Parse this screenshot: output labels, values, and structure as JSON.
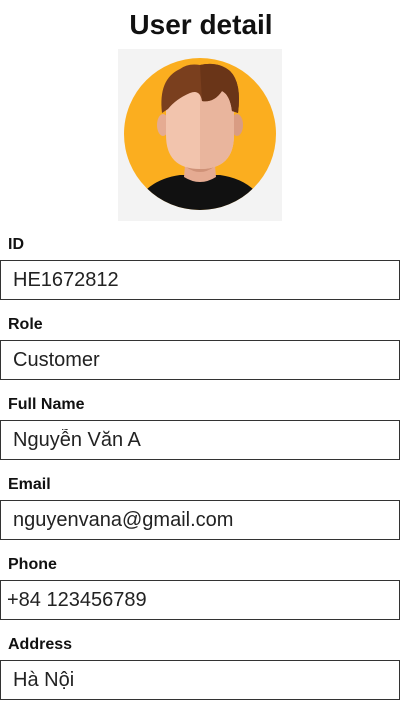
{
  "page": {
    "title": "User detail"
  },
  "avatar": {
    "icon": "user-avatar-icon",
    "background_color": "#fbae1f",
    "hair_color": "#7a3f1e",
    "skin_color": "#f2c4ad",
    "shirt_color": "#111111"
  },
  "fields": {
    "id": {
      "label": "ID",
      "value": "HE1672812"
    },
    "role": {
      "label": "Role",
      "value": "Customer"
    },
    "full_name": {
      "label": "Full Name",
      "value": "Nguyễn Văn A"
    },
    "email": {
      "label": "Email",
      "value": "nguyenvana@gmail.com"
    },
    "phone": {
      "label": "Phone",
      "value": "+84 123456789"
    },
    "address": {
      "label": "Address",
      "value": "Hà Nội"
    }
  }
}
